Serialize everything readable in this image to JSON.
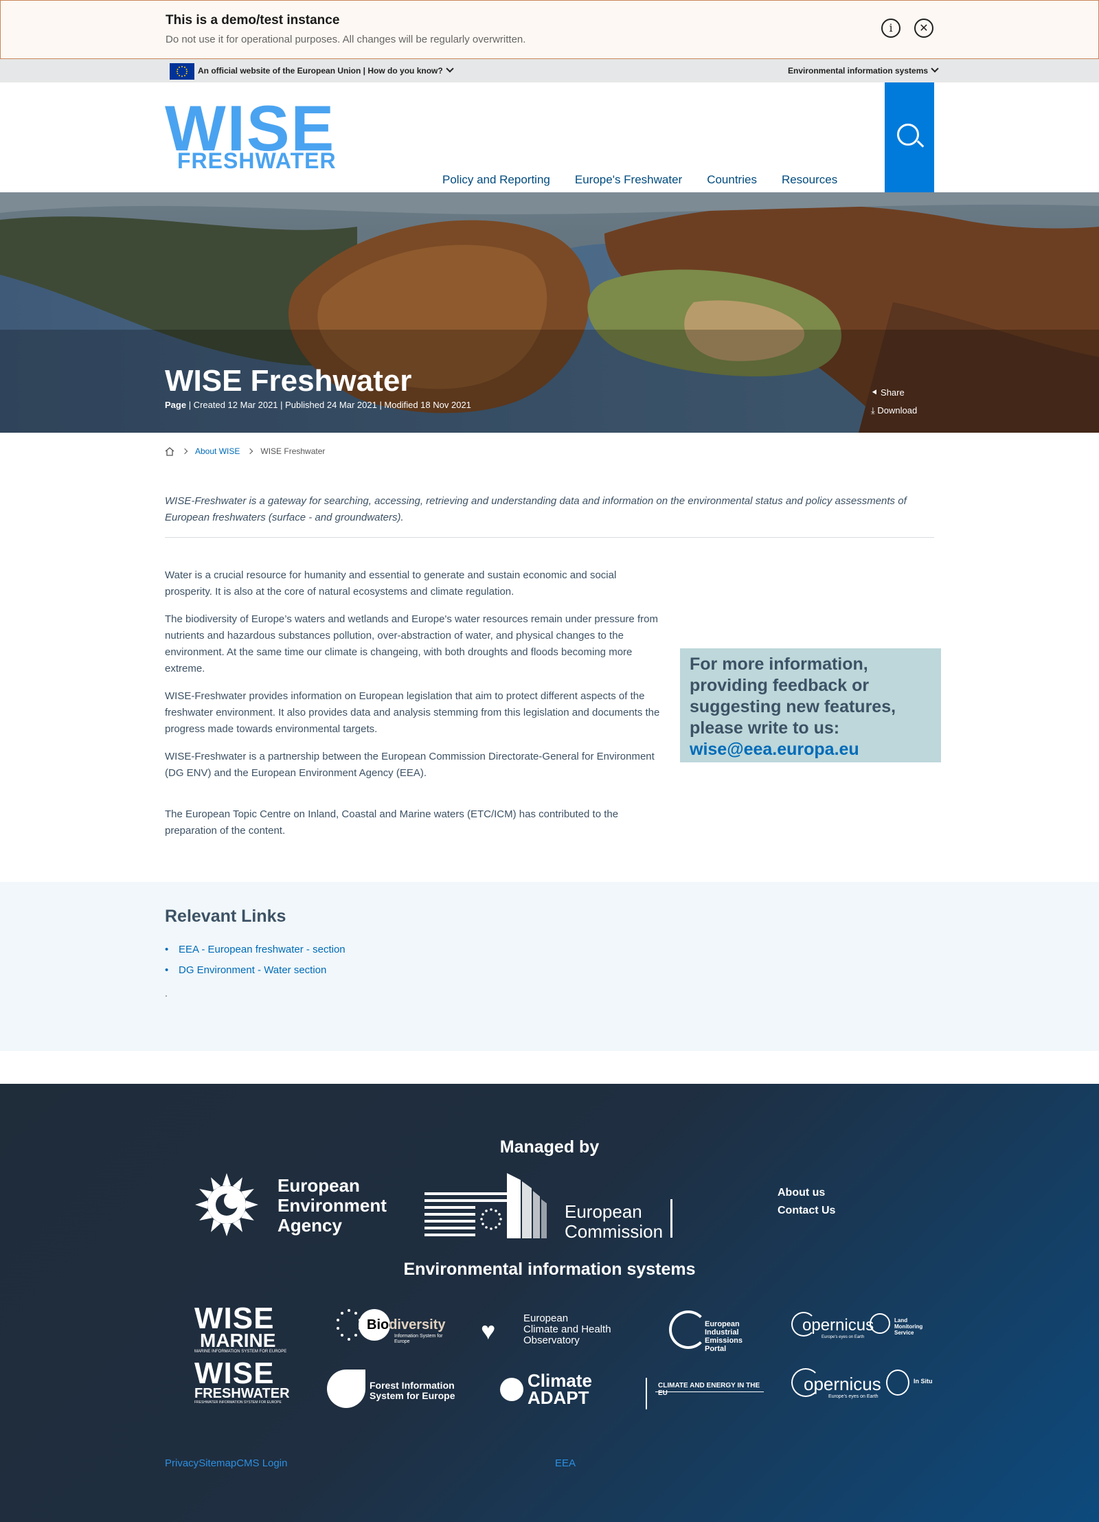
{
  "demo": {
    "title": "This is a demo/test instance",
    "text": "Do not use it for operational purposes. All changes will be regularly overwritten.",
    "info_icon": "info-icon",
    "close_icon": "close-icon"
  },
  "top_strip": {
    "left": "An official website of the European Union | How do you know?",
    "right": "Environmental information systems"
  },
  "header": {
    "logo_top": "WISE",
    "logo_bottom": "FRESHWATER",
    "nav": [
      "Policy and Reporting",
      "Europe's Freshwater",
      "Countries",
      "Resources"
    ],
    "search_icon": "search-icon"
  },
  "hero": {
    "title": "WISE Freshwater",
    "type": "Page",
    "meta": " | Created 12 Mar 2021 | Published 24 Mar 2021 | Modified 18 Nov 2021",
    "share": "Share",
    "download": "Download"
  },
  "breadcrumb": {
    "home_icon": "home-icon",
    "items": [
      "About WISE",
      "WISE Freshwater"
    ]
  },
  "content": {
    "lead": "WISE-Freshwater is a gateway for searching, accessing, retrieving and understanding data and information on the environmental status and policy assessments of European freshwaters (surface - and groundwaters).",
    "paragraphs": [
      "Water is a crucial resource for humanity and essential to generate and sustain economic and social prosperity. It is also at the core of natural ecosystems and climate regulation.",
      "The biodiversity of Europe’s waters and wetlands and Europe's water resources remain under pressure from nutrients and hazardous substances pollution, over-abstraction of water, and physical changes to the environment. At the same time our climate is changeing, with both droughts and floods becoming more extreme.",
      "WISE-Freshwater provides information on European legislation that aim to protect different aspects of the freshwater environment. It also provides data and analysis stemming from this legislation and documents the progress made towards environmental targets.",
      "WISE-Freshwater is a partnership between the European Commission Directorate-General for Environment (DG ENV) and the European Environment Agency (EEA).",
      "The European Topic Centre on Inland, Coastal and Marine waters (ETC/ICM) has contributed to the preparation of the content."
    ],
    "infobox_text": "For more information, providing feedback or suggesting new features, please write to us:",
    "infobox_email": "wise@eea.europa.eu"
  },
  "links": {
    "title": "Relevant Links",
    "items": [
      "EEA - European freshwater - section",
      "DG Environment - Water section"
    ],
    "trailing": "."
  },
  "footer": {
    "managed_by": "Managed by",
    "eea_name_1": "European",
    "eea_name_2": "Environment",
    "eea_name_3": "Agency",
    "ec_name_1": "European",
    "ec_name_2": "Commission",
    "links": [
      "About us",
      "Contact Us"
    ],
    "eis_title": "Environmental information systems",
    "systems": {
      "wise_marine": "WISE",
      "wise_marine_sub": "MARINE",
      "wise_marine_tiny": "MARINE INFORMATION SYSTEM FOR EUROPE",
      "biodiversity": "Biodiversity",
      "biodiversity_sub": "Information System for Europe",
      "climate_health_1": "European",
      "climate_health_2": "Climate and Health",
      "climate_health_3": "Observatory",
      "industrial_1": "European",
      "industrial_2": "Industrial",
      "industrial_3": "Emissions",
      "industrial_4": "Portal",
      "copernicus_1": "opernicus",
      "copernicus_1_sub": "Europe's eyes on Earth",
      "copernicus_1_service": "Land Monitoring Service",
      "wise_fresh": "WISE",
      "wise_fresh_sub": "FRESHWATER",
      "wise_fresh_tiny": "FRESHWATER INFORMATION SYSTEM FOR EUROPE",
      "forest_1": "Forest Information",
      "forest_2": "System for Europe",
      "climate_adapt_1": "Climate",
      "climate_adapt_2": "ADAPT",
      "climate_energy": "CLIMATE AND ENERGY IN THE EU",
      "copernicus_2": "opernicus",
      "copernicus_2_sub": "Europe's eyes on Earth",
      "copernicus_2_service": "In Situ"
    },
    "bottom_links": [
      "Privacy",
      "Sitemap",
      "CMS Login"
    ],
    "bottom_eea": "EEA"
  }
}
